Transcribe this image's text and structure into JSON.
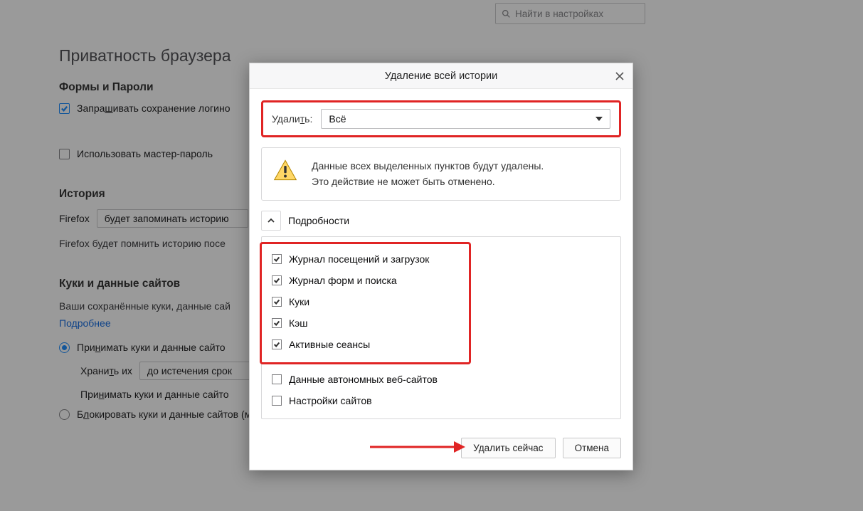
{
  "search": {
    "placeholder": "Найти в настройках"
  },
  "sections": {
    "privacy_title": "Приватность браузера",
    "forms_passwords_title": "Формы и Пароли",
    "ask_save_logins": "Запрашивать сохранение логино",
    "use_master_password": "Использовать мастер-пароль",
    "history_title": "История",
    "history_firefox_prefix": "Firefox",
    "history_mode_value": "будет запоминать историю",
    "history_desc": "Firefox будет помнить историю посе",
    "cookies_title": "Куки и данные сайтов",
    "cookies_desc": "Ваши сохранённые куки, данные сай",
    "learn_more": "Подробнее",
    "accept_cookies": "Принимать куки и данные сайто",
    "keep_label": "Хранить их",
    "keep_value": "до истечения срок",
    "accept_thirdparty": "Принимать куки и данные сайто",
    "block_cookies": "Блокировать куки и данные сайтов (может нарушить работу веб-сайтов)"
  },
  "dialog": {
    "title": "Удаление всей истории",
    "delete_label": "Удалить:",
    "range_value": "Всё",
    "warn1": "Данные всех выделенных пунктов будут удалены.",
    "warn2": "Это действие не может быть отменено.",
    "details": "Подробности",
    "items": {
      "browsing": "Журнал посещений и загрузок",
      "forms": "Журнал форм и поиска",
      "cookies": "Куки",
      "cache": "Кэш",
      "sessions": "Активные сеансы",
      "offline": "Данные автономных веб-сайтов",
      "site_settings": "Настройки сайтов"
    },
    "btn_delete": "Удалить сейчас",
    "btn_cancel": "Отмена"
  }
}
